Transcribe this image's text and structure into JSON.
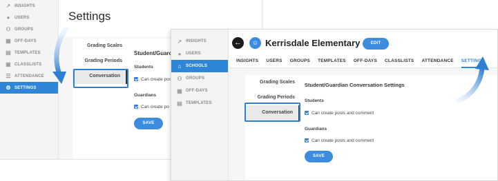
{
  "left_screen": {
    "sidebar": [
      {
        "icon": "trend-icon",
        "label": "INSIGHTS"
      },
      {
        "icon": "user-icon",
        "label": "USERS"
      },
      {
        "icon": "group-icon",
        "label": "GROUPS"
      },
      {
        "icon": "calendar-icon",
        "label": "OFF-DAYS"
      },
      {
        "icon": "template-icon",
        "label": "TEMPLATES"
      },
      {
        "icon": "classlist-icon",
        "label": "CLASSLISTS"
      },
      {
        "icon": "attendance-icon",
        "label": "ATTENDANCE"
      },
      {
        "icon": "gear-icon",
        "label": "SETTINGS",
        "active": true
      }
    ],
    "page_title": "Settings",
    "subnav": [
      "Grading Scales",
      "Grading Periods",
      "Conversation"
    ],
    "settings_title": "Student/Guardian",
    "students_label": "Students",
    "students_option": "Can create posts",
    "guardians_label": "Guardians",
    "guardians_option": "Can create po",
    "save_label": "SAVE"
  },
  "right_screen": {
    "sidebar": [
      {
        "icon": "trend-icon",
        "label": "INSIGHTS"
      },
      {
        "icon": "user-icon",
        "label": "USERS"
      },
      {
        "icon": "school-icon",
        "label": "SCHOOLS",
        "active": true
      },
      {
        "icon": "group-icon",
        "label": "GROUPS"
      },
      {
        "icon": "calendar-icon",
        "label": "OFF-DAYS"
      },
      {
        "icon": "template-icon",
        "label": "TEMPLATES"
      }
    ],
    "school_name": "Kerrisdale Elementary",
    "edit_label": "EDIT",
    "tabs": [
      "INSIGHTS",
      "USERS",
      "GROUPS",
      "TEMPLATES",
      "OFF-DAYS",
      "CLASSLISTS",
      "ATTENDANCE",
      "SETTINGS"
    ],
    "active_tab": "SETTINGS",
    "subnav": [
      "Grading Scales",
      "Grading Periods",
      "Conversation"
    ],
    "settings_title": "Student/Guardian Conversation Settings",
    "students_label": "Students",
    "students_option": "Can create posts and comment",
    "guardians_label": "Guardians",
    "guardians_option": "Can create posts and comment",
    "save_label": "SAVE"
  },
  "colors": {
    "accent": "#2f86d6",
    "highlight": "#2f7fd0",
    "button": "#3c8de0"
  }
}
